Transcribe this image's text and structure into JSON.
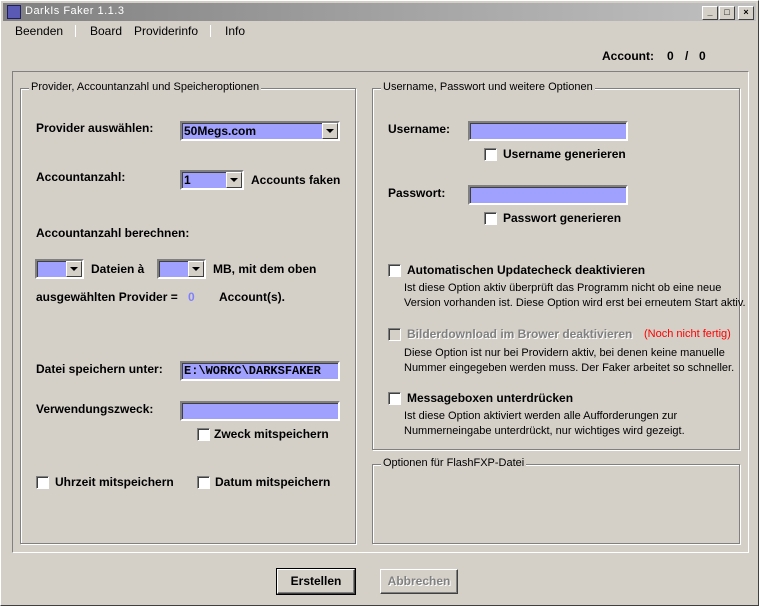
{
  "window": {
    "title": "DarkIs Faker  1.1.3",
    "controls": [
      "_",
      "□",
      "×"
    ]
  },
  "menu": {
    "beenden": "Beenden",
    "board": "Board",
    "providerinfo": "Providerinfo",
    "info": "Info"
  },
  "account": {
    "label": "Account:",
    "current": "0",
    "sep": "/",
    "total": "0"
  },
  "left_group": {
    "title": "Provider, Accountanzahl und Speicheroptionen",
    "provider_label": "Provider auswählen:",
    "provider_value": "50Megs.com",
    "accountanzahl_label": "Accountanzahl:",
    "accountanzahl_value": "1",
    "accounts_faken": "Accounts faken",
    "berechnen_label": "Accountanzahl berechnen:",
    "dateien_a": "Dateien à",
    "mb_text": "MB, mit dem oben",
    "ausgewaehlt_text": "ausgewählten Provider =",
    "result_value": "0",
    "accounts_suffix": "Account(s).",
    "datei_label": "Datei speichern unter:",
    "datei_value": "E:\\WORKC\\DARKSFAKER",
    "zweck_label": "Verwendungszweck:",
    "zweck_value": "",
    "zweck_mitspeichern": "Zweck mitspeichern",
    "uhrzeit_mitspeichern": "Uhrzeit mitspeichern",
    "datum_mitspeichern": "Datum mitspeichern"
  },
  "right_group": {
    "title": "Username, Passwort und weitere Optionen",
    "username_label": "Username:",
    "username_value": "",
    "username_generieren": "Username generieren",
    "passwort_label": "Passwort:",
    "passwort_value": "",
    "passwort_generieren": "Passwort generieren",
    "updatecheck_label": "Automatischen Updatecheck deaktivieren",
    "updatecheck_desc1": "Ist diese Option aktiv überprüft das Programm nicht ob eine neue",
    "updatecheck_desc2": "Version vorhanden ist. Diese Option wird erst bei erneutem Start aktiv.",
    "bilder_label": "Bilderdownload im Brower deaktivieren",
    "bilder_note": "(Noch nicht fertig)",
    "bilder_desc1": "Diese Option ist nur bei Providern aktiv, bei denen keine manuelle",
    "bilder_desc2": "Nummer eingegeben werden muss. Der Faker arbeitet so schneller.",
    "msgbox_label": "Messageboxen unterdrücken",
    "msgbox_desc1": "Ist diese Option aktiviert werden alle Aufforderungen zur",
    "msgbox_desc2": "Nummerneingabe unterdrückt, nur wichtiges wird gezeigt."
  },
  "flashfxp_group": {
    "title": "Optionen für FlashFXP-Datei"
  },
  "buttons": {
    "erstellen": "Erstellen",
    "abbrechen": "Abbrechen"
  },
  "colors": {
    "field_bg": "#a0a0ff",
    "window_bg": "#d4d0c8",
    "note_red": "#ff0000",
    "result_blue": "#8080ff"
  }
}
